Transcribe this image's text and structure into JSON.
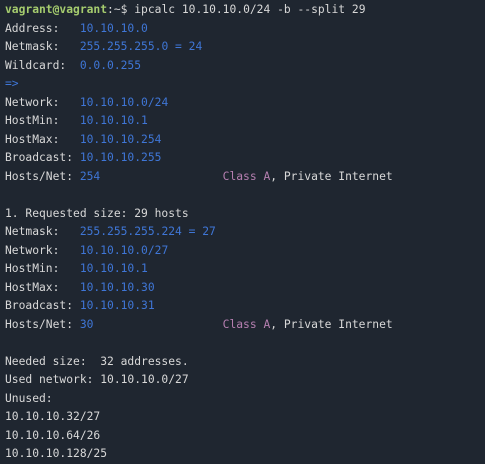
{
  "colors": {
    "background": "#1f2630",
    "prompt": "#a5cc6e",
    "value": "#3f76d6",
    "class": "#b57fb0",
    "text": "#d8d8d8"
  },
  "lines": [
    [
      {
        "t": "vagrant@vagrant",
        "c": "g"
      },
      {
        "t": ":~$ ",
        "c": "w"
      },
      {
        "t": "ipcalc 10.10.10.0/24 -b --split 29",
        "c": "w"
      }
    ],
    [
      {
        "t": "Address:   ",
        "c": "w"
      },
      {
        "t": "10.10.10.0",
        "c": "b"
      }
    ],
    [
      {
        "t": "Netmask:   ",
        "c": "w"
      },
      {
        "t": "255.255.255.0 = 24",
        "c": "b"
      }
    ],
    [
      {
        "t": "Wildcard:  ",
        "c": "w"
      },
      {
        "t": "0.0.0.255",
        "c": "b"
      }
    ],
    [
      {
        "t": "=>",
        "c": "b"
      }
    ],
    [
      {
        "t": "Network:   ",
        "c": "w"
      },
      {
        "t": "10.10.10.0/24",
        "c": "b"
      }
    ],
    [
      {
        "t": "HostMin:   ",
        "c": "w"
      },
      {
        "t": "10.10.10.1",
        "c": "b"
      }
    ],
    [
      {
        "t": "HostMax:   ",
        "c": "w"
      },
      {
        "t": "10.10.10.254",
        "c": "b"
      }
    ],
    [
      {
        "t": "Broadcast: ",
        "c": "w"
      },
      {
        "t": "10.10.10.255",
        "c": "b"
      }
    ],
    [
      {
        "t": "Hosts/Net: ",
        "c": "w"
      },
      {
        "t": "254                  ",
        "c": "b"
      },
      {
        "t": "Class A",
        "c": "p"
      },
      {
        "t": ", Private Internet",
        "c": "w"
      }
    ],
    [],
    [
      {
        "t": "1. Requested size: 29 hosts",
        "c": "w"
      }
    ],
    [
      {
        "t": "Netmask:   ",
        "c": "w"
      },
      {
        "t": "255.255.255.224 = 27",
        "c": "b"
      }
    ],
    [
      {
        "t": "Network:   ",
        "c": "w"
      },
      {
        "t": "10.10.10.0/27",
        "c": "b"
      }
    ],
    [
      {
        "t": "HostMin:   ",
        "c": "w"
      },
      {
        "t": "10.10.10.1",
        "c": "b"
      }
    ],
    [
      {
        "t": "HostMax:   ",
        "c": "w"
      },
      {
        "t": "10.10.10.30",
        "c": "b"
      }
    ],
    [
      {
        "t": "Broadcast: ",
        "c": "w"
      },
      {
        "t": "10.10.10.31",
        "c": "b"
      }
    ],
    [
      {
        "t": "Hosts/Net: ",
        "c": "w"
      },
      {
        "t": "30                   ",
        "c": "b"
      },
      {
        "t": "Class A",
        "c": "p"
      },
      {
        "t": ", Private Internet",
        "c": "w"
      }
    ],
    [],
    [
      {
        "t": "Needed size:  32 addresses.",
        "c": "w"
      }
    ],
    [
      {
        "t": "Used network: 10.10.10.0/27",
        "c": "w"
      }
    ],
    [
      {
        "t": "Unused:",
        "c": "w"
      }
    ],
    [
      {
        "t": "10.10.10.32/27",
        "c": "w"
      }
    ],
    [
      {
        "t": "10.10.10.64/26",
        "c": "w"
      }
    ],
    [
      {
        "t": "10.10.10.128/25",
        "c": "w"
      }
    ]
  ]
}
